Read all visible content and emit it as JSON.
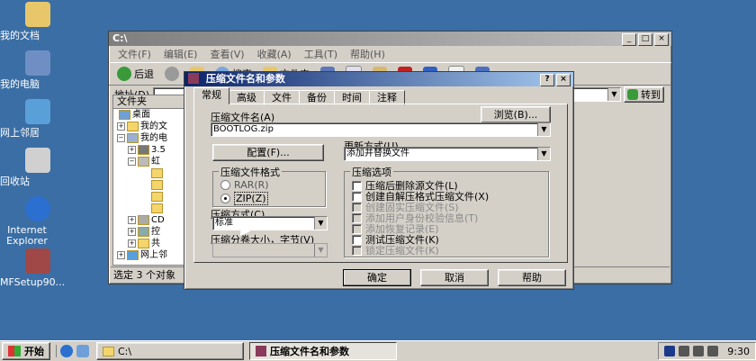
{
  "desktop": {
    "icons": [
      {
        "label": "我的文档",
        "icon": "my-documents-icon",
        "color": "#e8c76a"
      },
      {
        "label": "我的电脑",
        "icon": "my-computer-icon",
        "color": "#6f8fc4"
      },
      {
        "label": "网上邻居",
        "icon": "network-places-icon",
        "color": "#5aa0d8"
      },
      {
        "label": "回收站",
        "icon": "recycle-bin-icon",
        "color": "#d0d0d0"
      },
      {
        "label": "Internet Explorer",
        "icon": "ie-icon",
        "color": "#2b6fd1"
      },
      {
        "label": "MFSetup90...",
        "icon": "setup-icon",
        "color": "#a04848"
      }
    ]
  },
  "explorer": {
    "title": "C:\\",
    "menu": [
      "文件(F)",
      "编辑(E)",
      "查看(V)",
      "收藏(A)",
      "工具(T)",
      "帮助(H)"
    ],
    "toolbar": {
      "back": "后退",
      "search": "搜索",
      "folders": "文件夹"
    },
    "address_label": "地址(D)",
    "go_label": "转到",
    "tree_header": "文件夹",
    "tree": [
      "桌面",
      "我的文",
      "我的电",
      "3.5",
      "虹",
      "",
      "",
      "",
      "",
      "CD",
      "控",
      "共",
      "网上邻"
    ],
    "status": "选定 3 个对象"
  },
  "dialog": {
    "title": "压缩文件名和参数",
    "help_btn": "?",
    "close_btn": "×",
    "tabs": [
      "常规",
      "高级",
      "文件",
      "备份",
      "时间",
      "注释"
    ],
    "archive_name_label": "压缩文件名(A)",
    "browse_label": "浏览(B)...",
    "archive_name_value": "BOOTLOG.zip",
    "profiles_label": "配置(F)...",
    "update_mode_label": "更新方式(U)",
    "update_mode_value": "添加并替换文件",
    "format_group": "压缩文件格式",
    "format_rar": "RAR(R)",
    "format_zip": "ZIP(Z)",
    "method_label": "压缩方式(C)",
    "method_value": "标准",
    "volume_label": "压缩分卷大小，字节(V)",
    "options_group": "压缩选项",
    "options": [
      {
        "label": "压缩后删除源文件(L)",
        "enabled": true
      },
      {
        "label": "创建自解压格式压缩文件(X)",
        "enabled": true
      },
      {
        "label": "创建固实压缩文件(S)",
        "enabled": false
      },
      {
        "label": "添加用户身份校验信息(T)",
        "enabled": false
      },
      {
        "label": "添加恢复记录(E)",
        "enabled": false
      },
      {
        "label": "测试压缩文件(K)",
        "enabled": true
      },
      {
        "label": "锁定压缩文件(K)",
        "enabled": false
      }
    ],
    "ok": "确定",
    "cancel": "取消",
    "help": "帮助"
  },
  "taskbar": {
    "start": "开始",
    "tasks": [
      {
        "label": "C:\\"
      },
      {
        "label": "压缩文件名和参数"
      }
    ],
    "clock": "9:30"
  },
  "colors": {
    "desktop": "#3a6ea5",
    "title_active": "#0a246a"
  }
}
